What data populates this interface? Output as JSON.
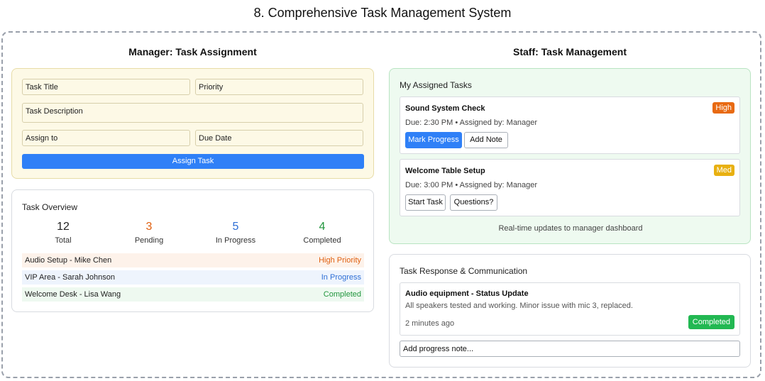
{
  "page": {
    "title": "8. Comprehensive Task Management System"
  },
  "manager": {
    "heading": "Manager: Task Assignment",
    "form": {
      "title_placeholder": "Task Title",
      "priority_placeholder": "Priority",
      "description_placeholder": "Task Description",
      "assign_placeholder": "Assign to",
      "due_placeholder": "Due Date",
      "submit_label": "Assign Task"
    },
    "overview": {
      "heading": "Task Overview",
      "stats": [
        {
          "value": "12",
          "label": "Total",
          "color": "#222222"
        },
        {
          "value": "3",
          "label": "Pending",
          "color": "#e06010"
        },
        {
          "value": "5",
          "label": "In Progress",
          "color": "#2f6fd6"
        },
        {
          "value": "4",
          "label": "Completed",
          "color": "#22963e"
        }
      ],
      "rows": [
        {
          "name": "Audio Setup - Mike Chen",
          "status": "High Priority",
          "bg": "#fdf2ea",
          "color": "#e06010"
        },
        {
          "name": "VIP Area - Sarah Johnson",
          "status": "In Progress",
          "bg": "#eef4fd",
          "color": "#2f6fd6"
        },
        {
          "name": "Welcome Desk - Lisa Wang",
          "status": "Completed",
          "bg": "#eef9f0",
          "color": "#22963e"
        }
      ]
    }
  },
  "staff": {
    "heading": "Staff: Task Management",
    "assigned": {
      "heading": "My Assigned Tasks",
      "tasks": [
        {
          "name": "Sound System Check",
          "meta": "Due: 2:30 PM • Assigned by: Manager",
          "badge": "High",
          "badge_color": "#e86a12",
          "actions": [
            "Mark Progress",
            "Add Note"
          ]
        },
        {
          "name": "Welcome Table Setup",
          "meta": "Due: 3:00 PM • Assigned by: Manager",
          "badge": "Med",
          "badge_color": "#e8b010",
          "actions": [
            "Start Task",
            "Questions?"
          ]
        }
      ],
      "footnote": "Real-time updates to manager dashboard"
    },
    "communication": {
      "heading": "Task Response & Communication",
      "message": {
        "title": "Audio equipment - Status Update",
        "body": "All speakers tested and working. Minor issue with mic 3, replaced.",
        "time": "2 minutes ago",
        "badge": "Completed"
      },
      "note_placeholder": "Add progress note..."
    }
  }
}
